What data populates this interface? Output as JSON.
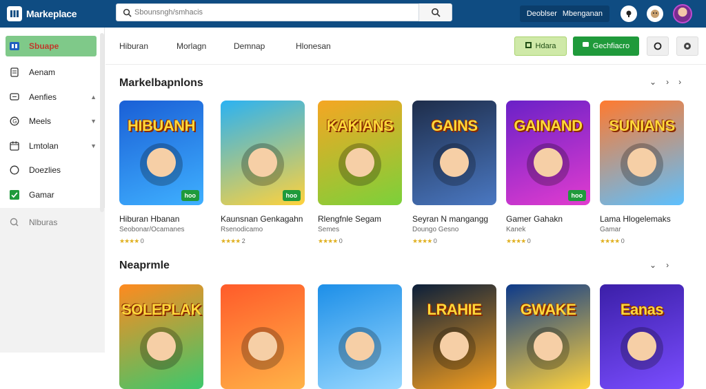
{
  "app": {
    "logo_text": "Markeplace",
    "search_placeholder": "Sbounsngh/smhacis",
    "user_chip": [
      "Deoblser",
      "Mbenganan"
    ]
  },
  "sidebar": {
    "items": [
      {
        "label": "Sbuape",
        "icon": "grid-icon",
        "active": true
      },
      {
        "label": "Aenam",
        "icon": "document-icon",
        "chevron": false
      },
      {
        "label": "Aenfies",
        "icon": "chat-icon",
        "chevron": true
      },
      {
        "label": "Meels",
        "icon": "circle-g-icon",
        "chevron": true
      },
      {
        "label": "Lmtolan",
        "icon": "calendar-icon",
        "chevron": true
      },
      {
        "label": "Doezlies",
        "icon": "radio-icon",
        "chevron": false
      },
      {
        "label": "Gamar",
        "icon": "checkbox-checked-icon",
        "chevron": false
      },
      {
        "label": "Nlburas",
        "icon": "search-small-icon",
        "chevron": false
      }
    ]
  },
  "tabs": [
    "Hiburan",
    "Morlagn",
    "Demnap",
    "Hlonesan"
  ],
  "actions": {
    "primary_light": "Hdara",
    "primary_dark": "Gechfiacro"
  },
  "sections": [
    {
      "title": "Markelbapnlons",
      "cards": [
        {
          "title": "Hiburan Hbanan",
          "subtitle": "Seobonar/Ocamanes",
          "rating": "0",
          "art_text": "HIBUANH",
          "badge": "hoo",
          "palette": [
            "#1a5fd6",
            "#3fb0ff"
          ]
        },
        {
          "title": "Kaunsnan Genkagahn",
          "subtitle": "Rsenodicamo",
          "rating": "2",
          "art_text": "",
          "badge": "hoo",
          "palette": [
            "#2bb2f2",
            "#ffd23c"
          ]
        },
        {
          "title": "Rlengfnle Segam",
          "subtitle": "Semes",
          "rating": "0",
          "art_text": "KAKIANS",
          "badge": "",
          "palette": [
            "#f5a623",
            "#7bd13a"
          ]
        },
        {
          "title": "Seyran N mangangg",
          "subtitle": "Doungo Gesno",
          "rating": "0",
          "art_text": "GAINS",
          "badge": "",
          "palette": [
            "#1e2d4a",
            "#4a78c2"
          ]
        },
        {
          "title": "Gamer Gahakn",
          "subtitle": "Kanek",
          "rating": "0",
          "art_text": "GAINAND",
          "badge": "hoo",
          "palette": [
            "#6a21c7",
            "#e13ccf"
          ]
        },
        {
          "title": "Lama Hlogelemaks",
          "subtitle": "Gamar",
          "rating": "0",
          "art_text": "SUNIANS",
          "badge": "",
          "palette": [
            "#ff7a2f",
            "#5cc0ff"
          ]
        }
      ]
    },
    {
      "title": "Neaprmle",
      "cards": [
        {
          "title": "",
          "subtitle": "",
          "rating": "",
          "art_text": "SOLEPLAK",
          "badge": "",
          "palette": [
            "#ff8a1f",
            "#3cc86c"
          ]
        },
        {
          "title": "",
          "subtitle": "",
          "rating": "",
          "art_text": "",
          "badge": "",
          "palette": [
            "#ff5b2a",
            "#ffb347"
          ]
        },
        {
          "title": "",
          "subtitle": "",
          "rating": "",
          "art_text": "",
          "badge": "",
          "palette": [
            "#1d8fe8",
            "#9ad9ff"
          ]
        },
        {
          "title": "",
          "subtitle": "",
          "rating": "",
          "art_text": "LRAHIE",
          "badge": "",
          "palette": [
            "#0b1f3a",
            "#f29d1f"
          ]
        },
        {
          "title": "",
          "subtitle": "",
          "rating": "",
          "art_text": "GWAKE",
          "badge": "",
          "palette": [
            "#0d3a8a",
            "#ffd23c"
          ]
        },
        {
          "title": "",
          "subtitle": "",
          "rating": "",
          "art_text": "Eanas",
          "badge": "",
          "palette": [
            "#3b1fa8",
            "#7a4dff"
          ]
        }
      ]
    }
  ]
}
